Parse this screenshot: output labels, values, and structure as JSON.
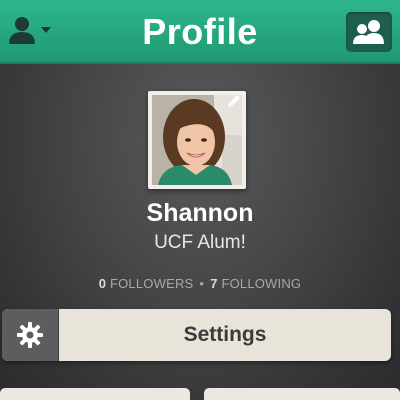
{
  "header": {
    "title": "Profile",
    "accent_color": "#2fb58c",
    "user_menu_icon": "user-dropdown-icon",
    "friends_icon": "friends-icon"
  },
  "profile": {
    "name": "Shannon",
    "bio": "UCF Alum!",
    "followers_count": "0",
    "followers_label": "FOLLOWERS",
    "separator": "•",
    "following_count": "7",
    "following_label": "FOLLOWING",
    "edit_icon": "pencil-icon"
  },
  "settings": {
    "label": "Settings",
    "icon": "gear-icon"
  }
}
